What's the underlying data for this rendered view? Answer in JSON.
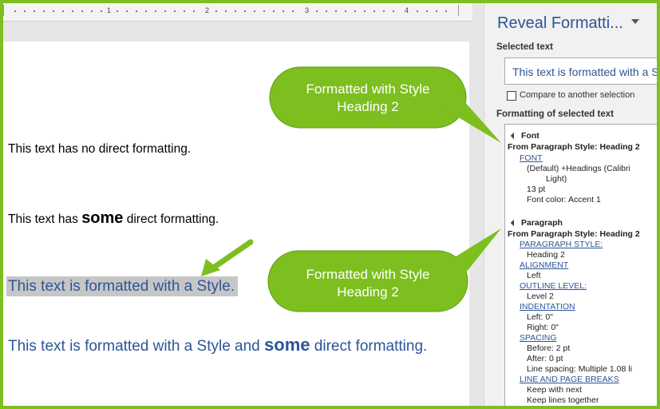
{
  "ruler": {
    "numbers": [
      "1",
      "2",
      "3",
      "4"
    ]
  },
  "document": {
    "line1": "This text has no direct formatting.",
    "line2_before": "This text has ",
    "line2_bold": "some",
    "line2_after": " direct formatting.",
    "line3": "This text is formatted with a Style.",
    "line4_before": "This text is formatted with a Style and ",
    "line4_bold": "some",
    "line4_after": " direct formatting."
  },
  "callouts": {
    "top": {
      "line1": "Formatted with Style",
      "line2": "Heading 2"
    },
    "bottom": {
      "line1": "Formatted with Style",
      "line2": "Heading 2"
    }
  },
  "pane": {
    "title": "Reveal Formatti...",
    "selected_text_label": "Selected text",
    "selected_text_value": "This text is formatted with a Style.",
    "compare_label": "Compare to another selection",
    "formatting_label": "Formatting of selected text",
    "font_section": {
      "header": "Font",
      "source": "From Paragraph Style: Heading 2",
      "link": "FONT",
      "value1a": "(Default) +Headings (Calibri",
      "value1b": "Light)",
      "value2": "13 pt",
      "value3": "Font color: Accent 1"
    },
    "paragraph_section": {
      "header": "Paragraph",
      "source": "From Paragraph Style: Heading 2",
      "paragraph_style_link": "PARAGRAPH STYLE:",
      "paragraph_style_value": "Heading 2",
      "alignment_link": "ALIGNMENT",
      "alignment_value": "Left",
      "outline_link": "OUTLINE LEVEL:",
      "outline_value": "Level 2",
      "indentation_link": "INDENTATION",
      "indent_left": "Left:  0\"",
      "indent_right": "Right:  0\"",
      "spacing_link": "SPACING",
      "spacing_before": "Before:  2 pt",
      "spacing_after": "After:  0 pt",
      "line_spacing": "Line spacing:  Multiple 1.08 li",
      "breaks_link": "LINE AND PAGE BREAKS",
      "keep_next": "Keep with next",
      "keep_lines": "Keep lines together"
    }
  },
  "colors": {
    "accent_green": "#7cbf1e",
    "heading_blue": "#2e5597"
  }
}
